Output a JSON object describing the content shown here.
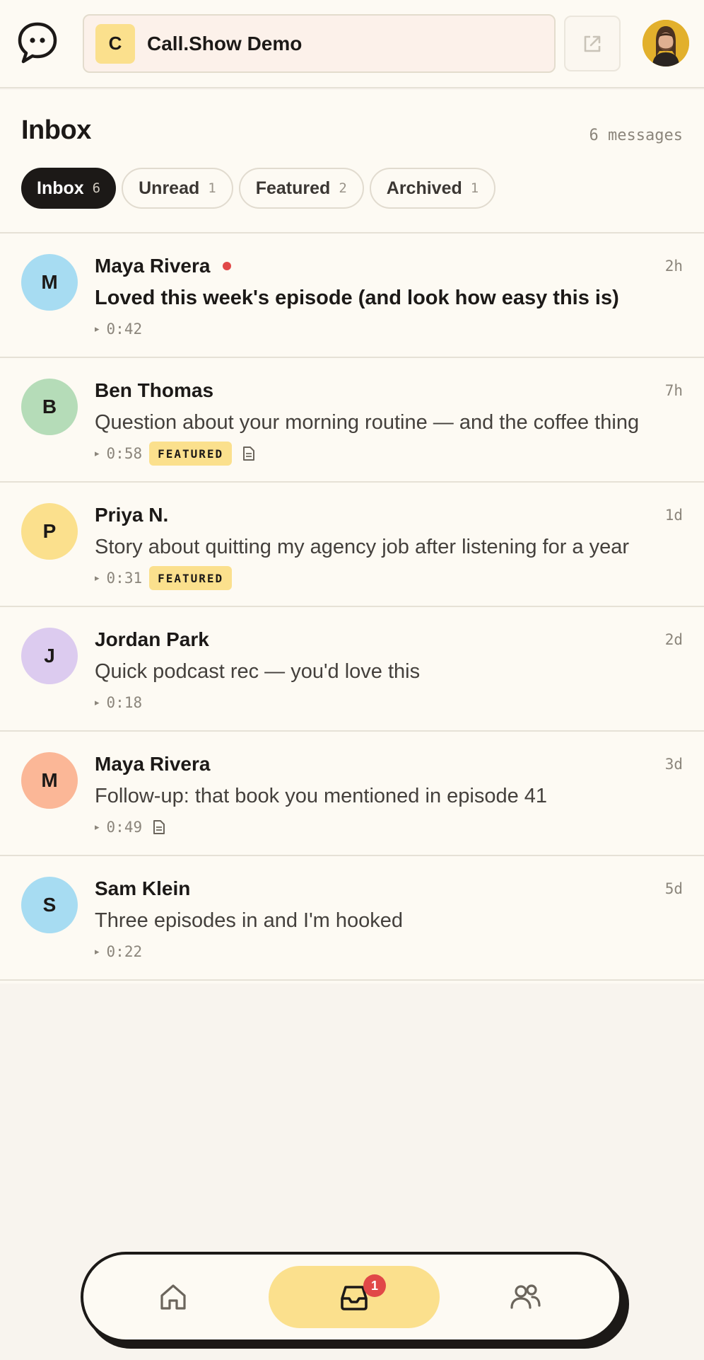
{
  "header": {
    "show_initial": "C",
    "show_name": "Call.Show Demo"
  },
  "inbox": {
    "title": "Inbox",
    "message_count": "6 messages",
    "tabs": [
      {
        "label": "Inbox",
        "count": "6",
        "active": true
      },
      {
        "label": "Unread",
        "count": "1",
        "active": false
      },
      {
        "label": "Featured",
        "count": "2",
        "active": false
      },
      {
        "label": "Archived",
        "count": "1",
        "active": false
      }
    ],
    "messages": [
      {
        "initial": "M",
        "name": "Maya Rivera",
        "unread": true,
        "time": "2h",
        "subject": "Loved this week's episode (and look how easy this is)",
        "duration": "0:42",
        "featured": false,
        "transcript": false,
        "avatar_color": "#a7dcf2"
      },
      {
        "initial": "B",
        "name": "Ben Thomas",
        "unread": false,
        "time": "7h",
        "subject": "Question about your morning routine — and the coffee thing",
        "duration": "0:58",
        "featured": true,
        "transcript": true,
        "avatar_color": "#b5dcb8"
      },
      {
        "initial": "P",
        "name": "Priya N.",
        "unread": false,
        "time": "1d",
        "subject": "Story about quitting my agency job after listening for a year",
        "duration": "0:31",
        "featured": true,
        "transcript": false,
        "avatar_color": "#fbe08d"
      },
      {
        "initial": "J",
        "name": "Jordan Park",
        "unread": false,
        "time": "2d",
        "subject": "Quick podcast rec — you'd love this",
        "duration": "0:18",
        "featured": false,
        "transcript": false,
        "avatar_color": "#dccbef"
      },
      {
        "initial": "M",
        "name": "Maya Rivera",
        "unread": false,
        "time": "3d",
        "subject": "Follow-up: that book you mentioned in episode 41",
        "duration": "0:49",
        "featured": false,
        "transcript": true,
        "avatar_color": "#fbb797"
      },
      {
        "initial": "S",
        "name": "Sam Klein",
        "unread": false,
        "time": "5d",
        "subject": "Three episodes in and I'm hooked",
        "duration": "0:22",
        "featured": false,
        "transcript": false,
        "avatar_color": "#a7dcf2"
      }
    ],
    "featured_badge": "FEATURED",
    "play_glyph": "▸"
  },
  "nav": {
    "inbox_badge": "1",
    "items": [
      "home-icon",
      "inbox-icon",
      "people-icon"
    ]
  },
  "colors": {
    "accent": "#fbe08d",
    "unread": "#e14848",
    "ink": "#1c1917"
  }
}
